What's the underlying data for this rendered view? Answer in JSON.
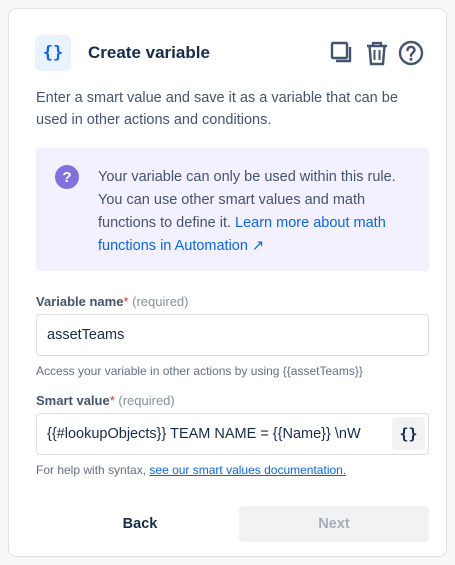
{
  "header": {
    "icon_glyph": "{}",
    "title": "Create variable",
    "icons": [
      "duplicate-icon",
      "trash-icon",
      "help-icon"
    ]
  },
  "intro": "Enter a smart value and save it as a variable that can be used in other actions and conditions.",
  "info": {
    "icon": "question-icon",
    "text": "Your variable can only be used within this rule. You can use other smart values and math functions to define it.",
    "link": "Learn more about math functions in Automation ↗"
  },
  "variable_name": {
    "label": "Variable name",
    "required_mark": "*",
    "required_text": "(required)",
    "value": "assetTeams",
    "helper": "Access your variable in other actions by using {{assetTeams}}"
  },
  "smart_value": {
    "label": "Smart value",
    "required_mark": "*",
    "required_text": "(required)",
    "value": "{{#lookupObjects}} TEAM NAME = {{Name}} \\nW",
    "insert_glyph": "{}",
    "helper": "For help with syntax,",
    "helper_link": "see our smart values documentation."
  },
  "footer": {
    "back": "Back",
    "next": "Next"
  },
  "colors": {
    "accent": "#0c66e4",
    "info_bg": "#f3f0ff",
    "info_icon": "#8270db",
    "required": "#c9372c",
    "disabled_bg": "#f1f2f4"
  }
}
